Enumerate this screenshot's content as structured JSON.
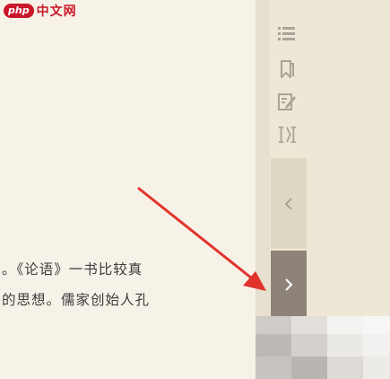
{
  "watermark": {
    "badge": "php",
    "text": "中文网"
  },
  "content": {
    "lines": [
      "。《论语》一书比较真",
      "的思想。儒家创始人孔"
    ]
  },
  "sidebar": {
    "tools": [
      {
        "icon": "toc-list-icon"
      },
      {
        "icon": "bookmark-icon"
      },
      {
        "icon": "note-edit-icon"
      },
      {
        "icon": "font-size-icon"
      }
    ],
    "prev_icon": "chevron-left-icon",
    "next_icon": "chevron-right-icon"
  },
  "colors": {
    "accent_arrow": "#e0332b",
    "next_button": "#8e8378",
    "prev_button": "#ddd8c3",
    "watermark": "#c9182a"
  }
}
